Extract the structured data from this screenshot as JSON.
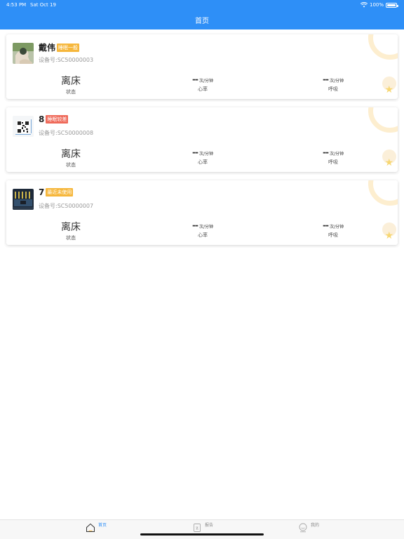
{
  "status_bar": {
    "time": "4:53 PM",
    "date": "Sat Oct 19",
    "battery": "100%"
  },
  "header": {
    "title": "首页"
  },
  "colors": {
    "primary": "#2e8ff7",
    "badge_orange": "#f6b73c",
    "badge_red": "#ef6b5b"
  },
  "devices": [
    {
      "name": "戴伟",
      "badge": "睡眠一般",
      "badge_color": "#f6b73c",
      "device_id": "设备号:SC50000003",
      "status_value": "离床",
      "status_label": "状态",
      "heart_value": "--",
      "heart_unit": "次/分钟",
      "heart_label": "心率",
      "breath_value": "--",
      "breath_unit": "次/分钟",
      "breath_label": "呼吸",
      "avatar_icon": "person-photo-icon"
    },
    {
      "name": "8",
      "badge": "睡眠较差",
      "badge_color": "#ef6b5b",
      "device_id": "设备号:SC50000008",
      "status_value": "离床",
      "status_label": "状态",
      "heart_value": "--",
      "heart_unit": "次/分钟",
      "heart_label": "心率",
      "breath_value": "--",
      "breath_unit": "次/分钟",
      "breath_label": "呼吸",
      "avatar_icon": "qr-code-icon"
    },
    {
      "name": "7",
      "badge": "最近未使用",
      "badge_color": "#f6b73c",
      "device_id": "设备号:SC50000007",
      "status_value": "离床",
      "status_label": "状态",
      "heart_value": "--",
      "heart_unit": "次/分钟",
      "heart_label": "心率",
      "breath_value": "--",
      "breath_unit": "次/分钟",
      "breath_label": "呼吸",
      "avatar_icon": "device-photo-icon"
    }
  ],
  "tabbar": {
    "tabs": [
      {
        "label": "首页",
        "icon": "home-icon",
        "active": true
      },
      {
        "label": "报告",
        "icon": "report-icon",
        "active": false
      },
      {
        "label": "我的",
        "icon": "profile-icon",
        "active": false
      }
    ]
  }
}
